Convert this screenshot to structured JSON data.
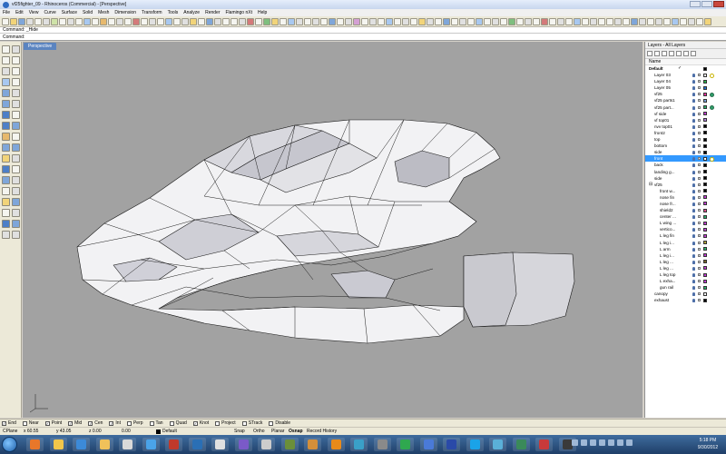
{
  "window": {
    "title": "vf25fighter_09 - Rhinoceros (Commercial) - [Perspective]"
  },
  "menus": [
    "File",
    "Edit",
    "View",
    "Curve",
    "Surface",
    "Solid",
    "Mesh",
    "Dimension",
    "Transform",
    "Tools",
    "Analyze",
    "Render",
    "Flamingo nXt",
    "Help"
  ],
  "command": {
    "history": "Command: _Hide",
    "prompt": "Command:"
  },
  "viewport": {
    "label": "Perspective"
  },
  "layers_panel": {
    "title": "Layers - All Layers",
    "column_name": "Name",
    "rows": [
      {
        "name": "Default",
        "indent": 0,
        "bold": true,
        "current": true,
        "color": "#000000"
      },
      {
        "name": "Layer 03",
        "indent": 1,
        "color": "#ffffff",
        "material": "#ffffff"
      },
      {
        "name": "Layer 04",
        "indent": 1,
        "color": "#2db34a"
      },
      {
        "name": "Layer 05",
        "indent": 1,
        "color": "#1f6fd1"
      },
      {
        "name": "vf25",
        "indent": 1,
        "color": "#ff2fa0",
        "material": "#2e9f6a"
      },
      {
        "name": "vf25 parts1",
        "indent": 1,
        "color": "#7aa0d8"
      },
      {
        "name": "vf25 part...",
        "indent": 1,
        "color": "#2bb36a",
        "material": "#2e9f6a"
      },
      {
        "name": "vf side",
        "indent": 1,
        "color": "#c23bd4"
      },
      {
        "name": "vf top01",
        "indent": 1,
        "color": "#b07ad8"
      },
      {
        "name": "nvv top01",
        "indent": 1,
        "color": "#000000"
      },
      {
        "name": "front2",
        "indent": 1,
        "color": "#000000"
      },
      {
        "name": "top",
        "indent": 1,
        "color": "#000000"
      },
      {
        "name": "bottom",
        "indent": 1,
        "color": "#000000"
      },
      {
        "name": "side",
        "indent": 1,
        "color": "#000000"
      },
      {
        "name": "front",
        "indent": 1,
        "selected": true,
        "color": "#ffffff",
        "material": "#ffffff"
      },
      {
        "name": "back",
        "indent": 1,
        "color": "#000000"
      },
      {
        "name": "landing g...",
        "indent": 1,
        "color": "#000000"
      },
      {
        "name": "side",
        "indent": 1,
        "color": "#000000"
      },
      {
        "name": "vf25",
        "indent": 1,
        "toggle": "⊟",
        "color": "#000000"
      },
      {
        "name": "front w...",
        "indent": 2,
        "color": "#000000"
      },
      {
        "name": "nose fin",
        "indent": 2,
        "color": "#c23bd4"
      },
      {
        "name": "nose fr...",
        "indent": 2,
        "color": "#c23bd4"
      },
      {
        "name": "shield2",
        "indent": 2,
        "color": "#d94f8c"
      },
      {
        "name": "center ...",
        "indent": 2,
        "color": "#2bb36a"
      },
      {
        "name": "L wing ...",
        "indent": 2,
        "color": "#c23bd4"
      },
      {
        "name": "vertico...",
        "indent": 2,
        "color": "#c23bd4"
      },
      {
        "name": "L leg fin",
        "indent": 2,
        "color": "#c23bd4"
      },
      {
        "name": "L leg i...",
        "indent": 2,
        "color": "#b4a53a"
      },
      {
        "name": "L arm",
        "indent": 2,
        "color": "#2bb36a"
      },
      {
        "name": "L leg i...",
        "indent": 2,
        "color": "#c23bd4"
      },
      {
        "name": "L leg ...",
        "indent": 2,
        "color": "#7a6a2a"
      },
      {
        "name": "L leg ...",
        "indent": 2,
        "color": "#c23bd4"
      },
      {
        "name": "L leg top",
        "indent": 2,
        "color": "#c23bd4"
      },
      {
        "name": "L exha...",
        "indent": 2,
        "color": "#c23bd4"
      },
      {
        "name": "gun rail",
        "indent": 2,
        "color": "#2bb36a"
      },
      {
        "name": "canopy",
        "indent": 1,
        "color": "#ffffff"
      },
      {
        "name": "exhaust",
        "indent": 1,
        "color": "#000000"
      }
    ]
  },
  "osnap": [
    {
      "label": "End",
      "checked": true
    },
    {
      "label": "Near",
      "checked": false
    },
    {
      "label": "Point",
      "checked": true
    },
    {
      "label": "Mid",
      "checked": true
    },
    {
      "label": "Cen",
      "checked": true
    },
    {
      "label": "Int",
      "checked": true
    },
    {
      "label": "Perp",
      "checked": false
    },
    {
      "label": "Tan",
      "checked": false
    },
    {
      "label": "Quad",
      "checked": false
    },
    {
      "label": "Knot",
      "checked": true
    },
    {
      "label": "Project",
      "checked": false
    },
    {
      "label": "STrack",
      "checked": false
    },
    {
      "label": "Disable",
      "checked": false
    }
  ],
  "status": {
    "cplane": "CPlane",
    "x": "x 60.55",
    "y": "y 43.05",
    "z": "z 0.00",
    "w": "0.00",
    "layer": "Default",
    "toggles": [
      "Snap",
      "Ortho",
      "Planar",
      "Osnap",
      "Record History"
    ]
  },
  "taskbar": {
    "time": "5:18 PM",
    "date": "9/30/2012"
  }
}
